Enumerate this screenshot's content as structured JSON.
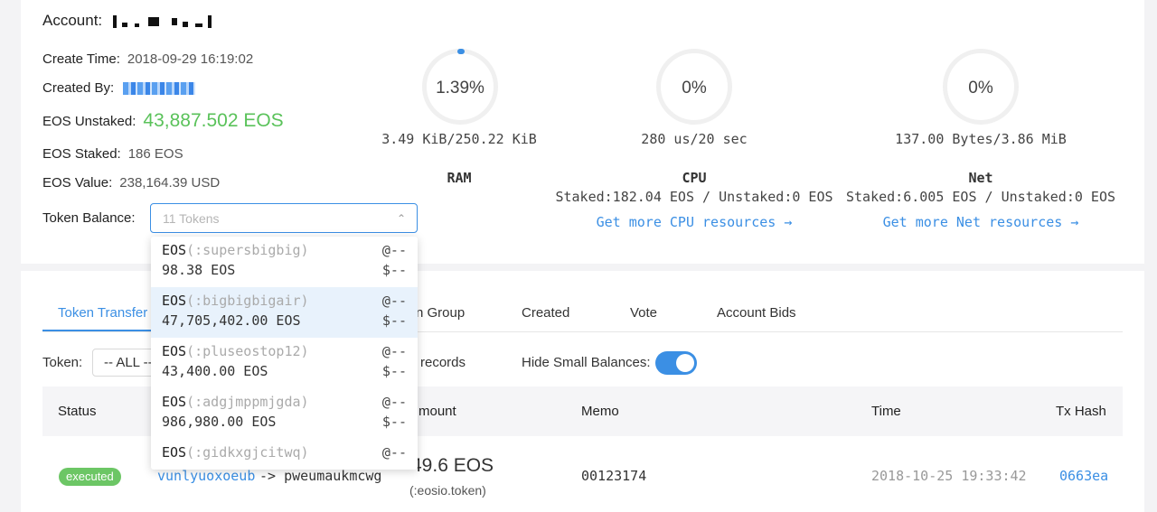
{
  "account": {
    "title": "Account:",
    "create_time_label": "Create Time:",
    "create_time": "2018-09-29 16:19:02",
    "created_by_label": "Created By:",
    "eos_unstaked_label": "EOS Unstaked:",
    "eos_unstaked": "43,887.502 EOS",
    "eos_staked_label": "EOS Staked:",
    "eos_staked": "186 EOS",
    "eos_value_label": "EOS Value:",
    "eos_value": "238,164.39 USD",
    "token_balance_label": "Token Balance:",
    "token_balance_placeholder": "11 Tokens"
  },
  "colors": {
    "accent": "#3b8fe4",
    "green": "#5ac25a",
    "executed_badge": "#6cc665"
  },
  "resources": [
    {
      "percent": "1.39%",
      "usage": "3.49 KiB/250.22 KiB",
      "label": "RAM",
      "staked": "",
      "link": ""
    },
    {
      "percent": "0%",
      "usage": "280 us/20 sec",
      "label": "CPU",
      "staked": "Staked:182.04 EOS / Unstaked:0 EOS",
      "link": "Get more CPU resources →"
    },
    {
      "percent": "0%",
      "usage": "137.00 Bytes/3.86 MiB",
      "label": "Net",
      "staked": "Staked:6.005 EOS / Unstaked:0 EOS",
      "link": "Get more Net resources →"
    }
  ],
  "token_dropdown": [
    {
      "symbol": "EOS",
      "contract": "(:supersbigbig)",
      "amount": "98.38 EOS",
      "price": "@--",
      "value": "$--"
    },
    {
      "symbol": "EOS",
      "contract": "(:bigbigbigair)",
      "amount": "47,705,402.00 EOS",
      "price": "@--",
      "value": "$--"
    },
    {
      "symbol": "EOS",
      "contract": "(:pluseostop12)",
      "amount": "43,400.00 EOS",
      "price": "@--",
      "value": "$--"
    },
    {
      "symbol": "EOS",
      "contract": "(:adgjmppmjgda)",
      "amount": "986,980.00 EOS",
      "price": "@--",
      "value": "$--"
    },
    {
      "symbol": "EOS",
      "contract": "(:gidkxgjcitwq)",
      "amount": "",
      "price": "@--",
      "value": ""
    }
  ],
  "tabs": [
    "Token Transfer",
    "n Group",
    "Created",
    "Vote",
    "Account Bids"
  ],
  "filter": {
    "token_label": "Token:",
    "token_value": "-- ALL --",
    "records_text": "records",
    "hide_small_label": "Hide Small Balances:",
    "hide_small_on": true
  },
  "table": {
    "headers": [
      "Status",
      "mount",
      "Memo",
      "Time",
      "Tx Hash"
    ],
    "rows": [
      {
        "status": "executed",
        "from": "vunlyuoxoeub",
        "arrow_to": "-> pweumaukmcwg",
        "amount": "49.6 EOS",
        "contract": "(:eosio.token)",
        "memo": "00123174",
        "time": "2018-10-25 19:33:42",
        "hash": "0663ea"
      }
    ]
  }
}
